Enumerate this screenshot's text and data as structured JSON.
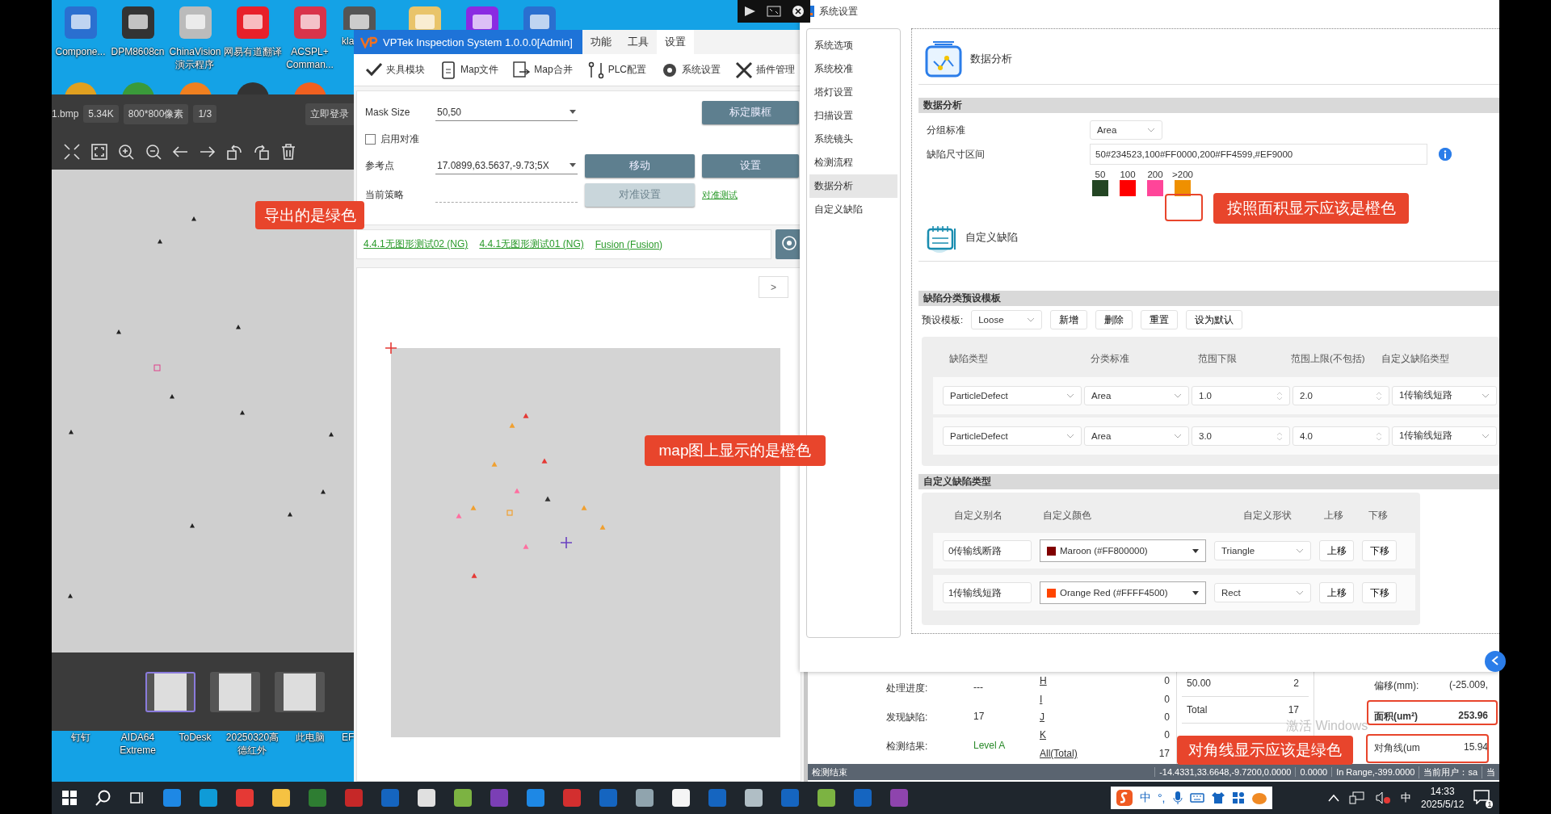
{
  "desktop": {
    "top_labels": [
      {
        "lines": [
          "Compone..."
        ]
      },
      {
        "lines": [
          "DPM8608cn"
        ]
      },
      {
        "lines": [
          "ChinaVision",
          "演示程序"
        ]
      },
      {
        "lines": [
          "网易有道翻译"
        ]
      },
      {
        "lines": [
          "ACSPL+",
          "Comman..."
        ]
      },
      {
        "lines": [
          "kla"
        ]
      }
    ],
    "bottom_labels": [
      {
        "lines": [
          "钉钉"
        ]
      },
      {
        "lines": [
          "AIDA64",
          "Extreme"
        ]
      },
      {
        "lines": [
          "ToDesk"
        ]
      },
      {
        "lines": [
          "20250320高",
          "德红外"
        ]
      },
      {
        "lines": [
          "此电脑"
        ]
      },
      {
        "lines": [
          "EF"
        ]
      }
    ],
    "os_notice": "激活 Windows"
  },
  "viewer": {
    "file": "1.bmp",
    "chips": [
      "5.34K",
      "800*800像素",
      "1/3"
    ],
    "login": "立即登录",
    "thumbnails": [
      {
        "selected": true
      },
      {
        "selected": false
      },
      {
        "selected": false
      }
    ]
  },
  "app": {
    "title": "VPTek Inspection System 1.0.0.0[Admin]",
    "menu": [
      {
        "label": "功能",
        "selected": false
      },
      {
        "label": "工具",
        "selected": false
      },
      {
        "label": "设置",
        "selected": true
      }
    ],
    "toolbar": [
      {
        "label": "夹具模块",
        "kind": "fixture"
      },
      {
        "label": "Map文件",
        "kind": "file"
      },
      {
        "label": "Map合并",
        "kind": "merge"
      },
      {
        "label": "PLC配置",
        "kind": "plc"
      },
      {
        "label": "系统设置",
        "kind": "settings"
      },
      {
        "label": "插件管理",
        "kind": "plugin"
      }
    ],
    "form": {
      "mask_label": "Mask Size",
      "mask_value": "50,50",
      "calibrate": "标定膜框",
      "align_label": "启用对准",
      "align_checked": false,
      "ref_label": "参考点",
      "ref_value": "17.0899,63.5637,-9.73;5X",
      "move": "移动",
      "set": "设置",
      "strategy_label": "当前策略",
      "align_settings": "对准设置",
      "align_settings_disabled": true,
      "align_test": "对准测试"
    },
    "links": [
      "4.4.1无图形测试02 (NG)",
      "4.4.1无图形测试01 (NG)",
      "Fusion (Fusion)"
    ],
    "map_next": ">",
    "stats": {
      "info": [
        {
          "label": "处理进度:",
          "value": "---",
          "kind": "plain"
        },
        {
          "label": "发现缺陷:",
          "value": "17",
          "kind": "plain"
        },
        {
          "label": "检测结果:",
          "value": "Level A",
          "kind": "pass"
        }
      ],
      "classes": [
        {
          "name": "H",
          "count": "0"
        },
        {
          "name": "I",
          "count": "0"
        },
        {
          "name": "J",
          "count": "0"
        },
        {
          "name": "K",
          "count": "0"
        },
        {
          "name": "All(Total)",
          "count": "17"
        }
      ],
      "bins": [
        {
          "range": "50.00",
          "count": "2"
        },
        {
          "range": "Total",
          "count": "17"
        }
      ],
      "measures": [
        {
          "label": "偏移(mm):",
          "value": "(-25.009,",
          "bold": false
        },
        {
          "label": "面积(um²)",
          "value": "253.96",
          "bold": true
        },
        {
          "label": "对角线(um",
          "value": "15.94",
          "bold": false
        }
      ]
    },
    "status_bar": [
      "检测结束",
      "-14.4331,33.6648,-9.7200,0.0000",
      "0.0000",
      "In Range,-399.0000",
      "当前用户：sa",
      "当"
    ]
  },
  "settings": {
    "title": "系统设置",
    "nav": [
      {
        "label": "系统选项",
        "selected": false
      },
      {
        "label": "系统校准",
        "selected": false
      },
      {
        "label": "塔灯设置",
        "selected": false
      },
      {
        "label": "扫描设置",
        "selected": false
      },
      {
        "label": "系统镜头",
        "selected": false
      },
      {
        "label": "检测流程",
        "selected": false
      },
      {
        "label": "数据分析",
        "selected": true
      },
      {
        "label": "自定义缺陷",
        "selected": false
      }
    ],
    "analysis": {
      "heading": "数据分析",
      "section": "数据分析",
      "group_label": "分组标准",
      "group_value": "Area",
      "range_label": "缺陷尺寸区间",
      "range_value": "50#234523,100#FF0000,200#FF4599,#EF9000",
      "bins": [
        {
          "label": "50",
          "color": "#234523"
        },
        {
          "label": "100",
          "color": "#ff0000"
        },
        {
          "label": "200",
          "color": "#ff4599"
        },
        {
          "label": ">200",
          "color": "#ef9000"
        }
      ]
    },
    "custom": {
      "heading": "自定义缺陷",
      "preset_section": "缺陷分类预设模板",
      "preset_label": "预设模板:",
      "preset_value": "Loose",
      "buttons": [
        "新增",
        "删除",
        "重置",
        "设为默认"
      ],
      "columns": [
        "缺陷类型",
        "分类标准",
        "范围下限",
        "范围上限(不包括)",
        "自定义缺陷类型"
      ],
      "rows": [
        [
          "ParticleDefect",
          "Area",
          "1.0",
          "2.0",
          "1传输线短路"
        ],
        [
          "ParticleDefect",
          "Area",
          "3.0",
          "4.0",
          "1传输线短路"
        ]
      ],
      "types_section": "自定义缺陷类型",
      "type_columns": [
        "自定义别名",
        "自定义颜色",
        "自定义形状",
        "上移",
        "下移"
      ],
      "types": [
        {
          "alias": "0传输线断路",
          "color_name": "Maroon (#FF800000)",
          "color": "#800000",
          "shape": "Triangle",
          "up": "上移",
          "down": "下移"
        },
        {
          "alias": "1传输线短路",
          "color_name": "Orange Red (#FFFF4500)",
          "color": "#ff4500",
          "shape": "Rect",
          "up": "上移",
          "down": "下移"
        }
      ]
    }
  },
  "taskbar": {
    "ime": "中",
    "ime_symbols": "°,",
    "lang": "中",
    "time": "14:33",
    "date": "2025/5/12",
    "notifications": "1"
  },
  "annotations": [
    {
      "kind": "label",
      "text": "导出的是绿色"
    },
    {
      "kind": "label",
      "text": "map图上显示的是橙色"
    },
    {
      "kind": "label",
      "text": "按照面积显示应该是橙色"
    },
    {
      "kind": "label",
      "text": "对角线显示应该是绿色"
    },
    {
      "kind": "outline"
    },
    {
      "kind": "outline"
    },
    {
      "kind": "outline"
    }
  ]
}
